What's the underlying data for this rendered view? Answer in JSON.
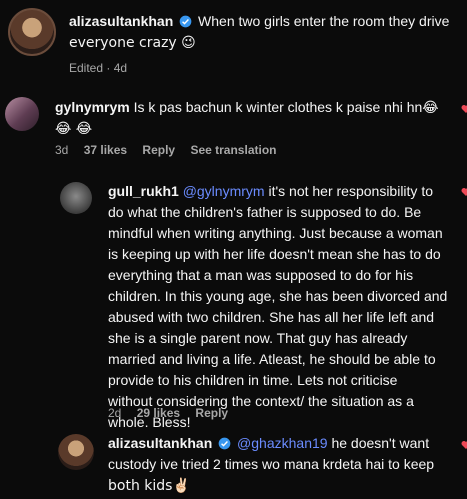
{
  "comments": [
    {
      "username": "alizasultankhan",
      "verified": true,
      "text_line1": "When two girls enter the room they drive",
      "text_line2": "everyone crazy 😉",
      "meta": {
        "time": "Edited · 4d"
      }
    },
    {
      "username": "gylnymrym",
      "verified": false,
      "text_line1": "Is k pas bachun k winter clothes k paise nhi hn😂",
      "text_line2": "😂 😂",
      "meta": {
        "time": "3d",
        "likes": "37 likes",
        "reply": "Reply",
        "translate": "See translation"
      }
    },
    {
      "username": "gull_rukh1",
      "mention": "@gylnymrym",
      "lines": [
        "it's not her responsibility to",
        "do what the children's father is supposed to do. Be",
        "mindful when writing anything. Just because a woman",
        "is keeping up with her life doesn't mean she has to do",
        "everything that a man was supposed to do for his",
        "children. In this young age, she has been divorced and",
        "abused with two children. She has all her life left and",
        "she is a single parent now. That guy has already",
        "married and living a life. Atleast, he should be able to",
        "provide to his children in time. Lets not criticise",
        "without considering the context/ the situation as a",
        "whole. Bless!"
      ],
      "meta": {
        "time": "2d",
        "likes": "29 likes",
        "reply": "Reply"
      }
    },
    {
      "username": "alizasultankhan",
      "verified": true,
      "mention": "@ghazkhan19",
      "text_line1": "he doesn't want",
      "text_line2": "custody ive tried 2 times wo mana krdeta hai to keep",
      "text_line3": "both kids✌🏻"
    }
  ],
  "colors": {
    "background": "#0b0b0b",
    "mention": "#6b8cff",
    "verified": "#3897f0",
    "heart": "#ed4956",
    "meta": "#a8a8a8"
  },
  "icons": [
    "verified-badge-icon",
    "heart-icon"
  ]
}
